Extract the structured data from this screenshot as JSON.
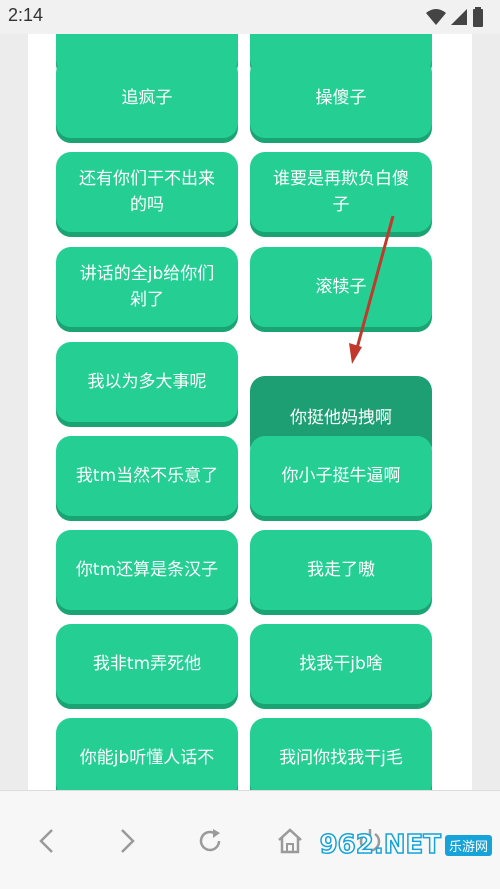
{
  "status_bar": {
    "time": "2:14",
    "icons": [
      "wifi-icon",
      "signal-icon",
      "battery-icon"
    ]
  },
  "buttons": [
    {
      "label": "追疯子",
      "col": "left"
    },
    {
      "label": "操傻子",
      "col": "right"
    },
    {
      "label": "还有你们干不出来的吗",
      "col": "left"
    },
    {
      "label": "谁要是再欺负白傻子",
      "col": "right"
    },
    {
      "label": "讲话的全jb给你们剁了",
      "col": "left"
    },
    {
      "label": "滚犊子",
      "col": "right"
    },
    {
      "label": "我以为多大事呢",
      "col": "left"
    },
    {
      "label": "你挺他妈拽啊",
      "col": "right",
      "pressed": true
    },
    {
      "label": "我tm当然不乐意了",
      "col": "left"
    },
    {
      "label": "你小子挺牛逼啊",
      "col": "right"
    },
    {
      "label": "你tm还算是条汉子",
      "col": "left"
    },
    {
      "label": "我走了嗷",
      "col": "right"
    },
    {
      "label": "我非tm弄死他",
      "col": "left"
    },
    {
      "label": "找我干jb啥",
      "col": "right"
    },
    {
      "label": "你能jb听懂人话不",
      "col": "left"
    },
    {
      "label": "我问你找我干j毛",
      "col": "right"
    }
  ],
  "nav_bar": {
    "items": [
      "back-icon",
      "forward-icon",
      "refresh-icon",
      "home-icon",
      "power-icon"
    ]
  },
  "watermark": {
    "site": "962.NET",
    "subtitle": "乐游网"
  },
  "colors": {
    "button": "#25cf93",
    "button_shadow": "#1aa373",
    "button_pressed": "#1e9f73",
    "arrow": "#c0392b"
  }
}
